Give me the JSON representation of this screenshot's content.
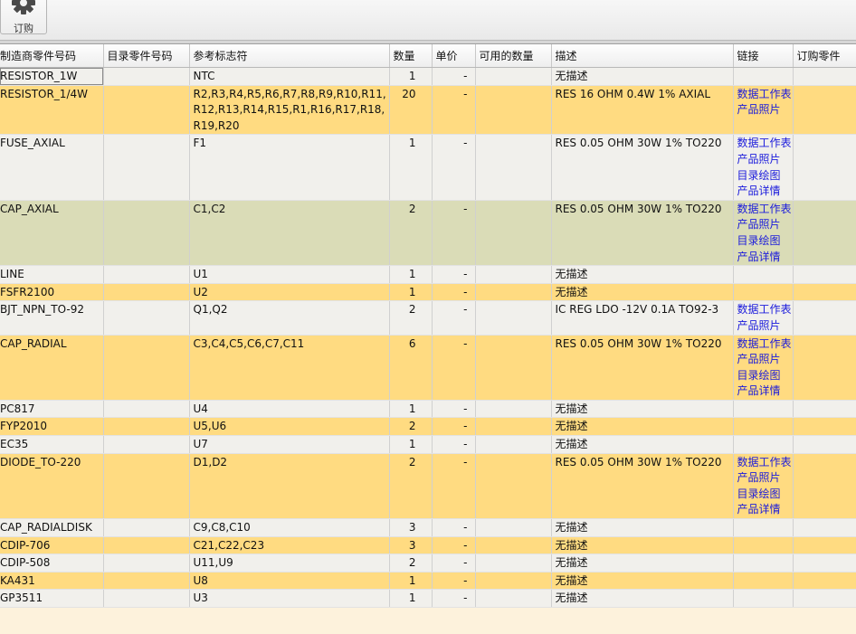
{
  "toolbar": {
    "order_label": "订购"
  },
  "columns": [
    "制造商零件号码",
    "目录零件号码",
    "参考标志符",
    "数量",
    "单价",
    "可用的数量",
    "描述",
    "链接",
    "订购零件"
  ],
  "rows": [
    {
      "mfr": "RESISTOR_1W",
      "cat": "",
      "ref": "NTC",
      "qty": "1",
      "price": "-",
      "avail": "",
      "desc": "无描述",
      "links": [],
      "order": ""
    },
    {
      "mfr": "RESISTOR_1/4W",
      "cat": "",
      "ref": "R2,R3,R4,R5,R6,R7,R8,R9,R10,R11,R12,R13,R14,R15,R1,R16,R17,R18,R19,R20",
      "qty": "20",
      "price": "-",
      "avail": "",
      "desc": "RES 16 OHM 0.4W 1% AXIAL",
      "links": [
        "数据工作表",
        "产品照片"
      ],
      "order": ""
    },
    {
      "mfr": "FUSE_AXIAL",
      "cat": "",
      "ref": "F1",
      "qty": "1",
      "price": "-",
      "avail": "",
      "desc": "RES 0.05 OHM 30W 1% TO220",
      "links": [
        "数据工作表",
        "产品照片",
        "目录绘图",
        "产品详情"
      ],
      "order": ""
    },
    {
      "mfr": "CAP_AXIAL",
      "cat": "",
      "ref": "C1,C2",
      "qty": "2",
      "price": "-",
      "avail": "",
      "desc": "RES 0.05 OHM 30W 1% TO220",
      "links": [
        "数据工作表",
        "产品照片",
        "目录绘图",
        "产品详情"
      ],
      "order": ""
    },
    {
      "mfr": "LINE",
      "cat": "",
      "ref": "U1",
      "qty": "1",
      "price": "-",
      "avail": "",
      "desc": "无描述",
      "links": [],
      "order": ""
    },
    {
      "mfr": "FSFR2100",
      "cat": "",
      "ref": "U2",
      "qty": "1",
      "price": "-",
      "avail": "",
      "desc": "无描述",
      "links": [],
      "order": ""
    },
    {
      "mfr": "BJT_NPN_TO-92",
      "cat": "",
      "ref": "Q1,Q2",
      "qty": "2",
      "price": "-",
      "avail": "",
      "desc": "IC REG LDO -12V 0.1A TO92-3",
      "links": [
        "数据工作表",
        "产品照片"
      ],
      "order": ""
    },
    {
      "mfr": "CAP_RADIAL",
      "cat": "",
      "ref": "C3,C4,C5,C6,C7,C11",
      "qty": "6",
      "price": "-",
      "avail": "",
      "desc": "RES 0.05 OHM 30W 1% TO220",
      "links": [
        "数据工作表",
        "产品照片",
        "目录绘图",
        "产品详情"
      ],
      "order": ""
    },
    {
      "mfr": "PC817",
      "cat": "",
      "ref": "U4",
      "qty": "1",
      "price": "-",
      "avail": "",
      "desc": "无描述",
      "links": [],
      "order": ""
    },
    {
      "mfr": "FYP2010",
      "cat": "",
      "ref": "U5,U6",
      "qty": "2",
      "price": "-",
      "avail": "",
      "desc": "无描述",
      "links": [],
      "order": ""
    },
    {
      "mfr": "EC35",
      "cat": "",
      "ref": "U7",
      "qty": "1",
      "price": "-",
      "avail": "",
      "desc": "无描述",
      "links": [],
      "order": ""
    },
    {
      "mfr": "DIODE_TO-220",
      "cat": "",
      "ref": "D1,D2",
      "qty": "2",
      "price": "-",
      "avail": "",
      "desc": "RES 0.05 OHM 30W 1% TO220",
      "links": [
        "数据工作表",
        "产品照片",
        "目录绘图",
        "产品详情"
      ],
      "order": ""
    },
    {
      "mfr": "CAP_RADIALDISK",
      "cat": "",
      "ref": "C9,C8,C10",
      "qty": "3",
      "price": "-",
      "avail": "",
      "desc": "无描述",
      "links": [],
      "order": ""
    },
    {
      "mfr": "CDIP-706",
      "cat": "",
      "ref": "C21,C22,C23",
      "qty": "3",
      "price": "-",
      "avail": "",
      "desc": "无描述",
      "links": [],
      "order": ""
    },
    {
      "mfr": "CDIP-508",
      "cat": "",
      "ref": "U11,U9",
      "qty": "2",
      "price": "-",
      "avail": "",
      "desc": "无描述",
      "links": [],
      "order": ""
    },
    {
      "mfr": "KA431",
      "cat": "",
      "ref": "U8",
      "qty": "1",
      "price": "-",
      "avail": "",
      "desc": "无描述",
      "links": [],
      "order": ""
    },
    {
      "mfr": "GP3511",
      "cat": "",
      "ref": "U3",
      "qty": "1",
      "price": "-",
      "avail": "",
      "desc": "无描述",
      "links": [],
      "order": ""
    }
  ],
  "selected_row": 3,
  "colors": {
    "row_odd": "#f1f0ec",
    "row_even": "#ffdb81",
    "row_selected": "#dadcb7",
    "link": "#1a1adc",
    "background": "#fdf2dc"
  },
  "icons": {
    "order_button": "gear-icon"
  }
}
